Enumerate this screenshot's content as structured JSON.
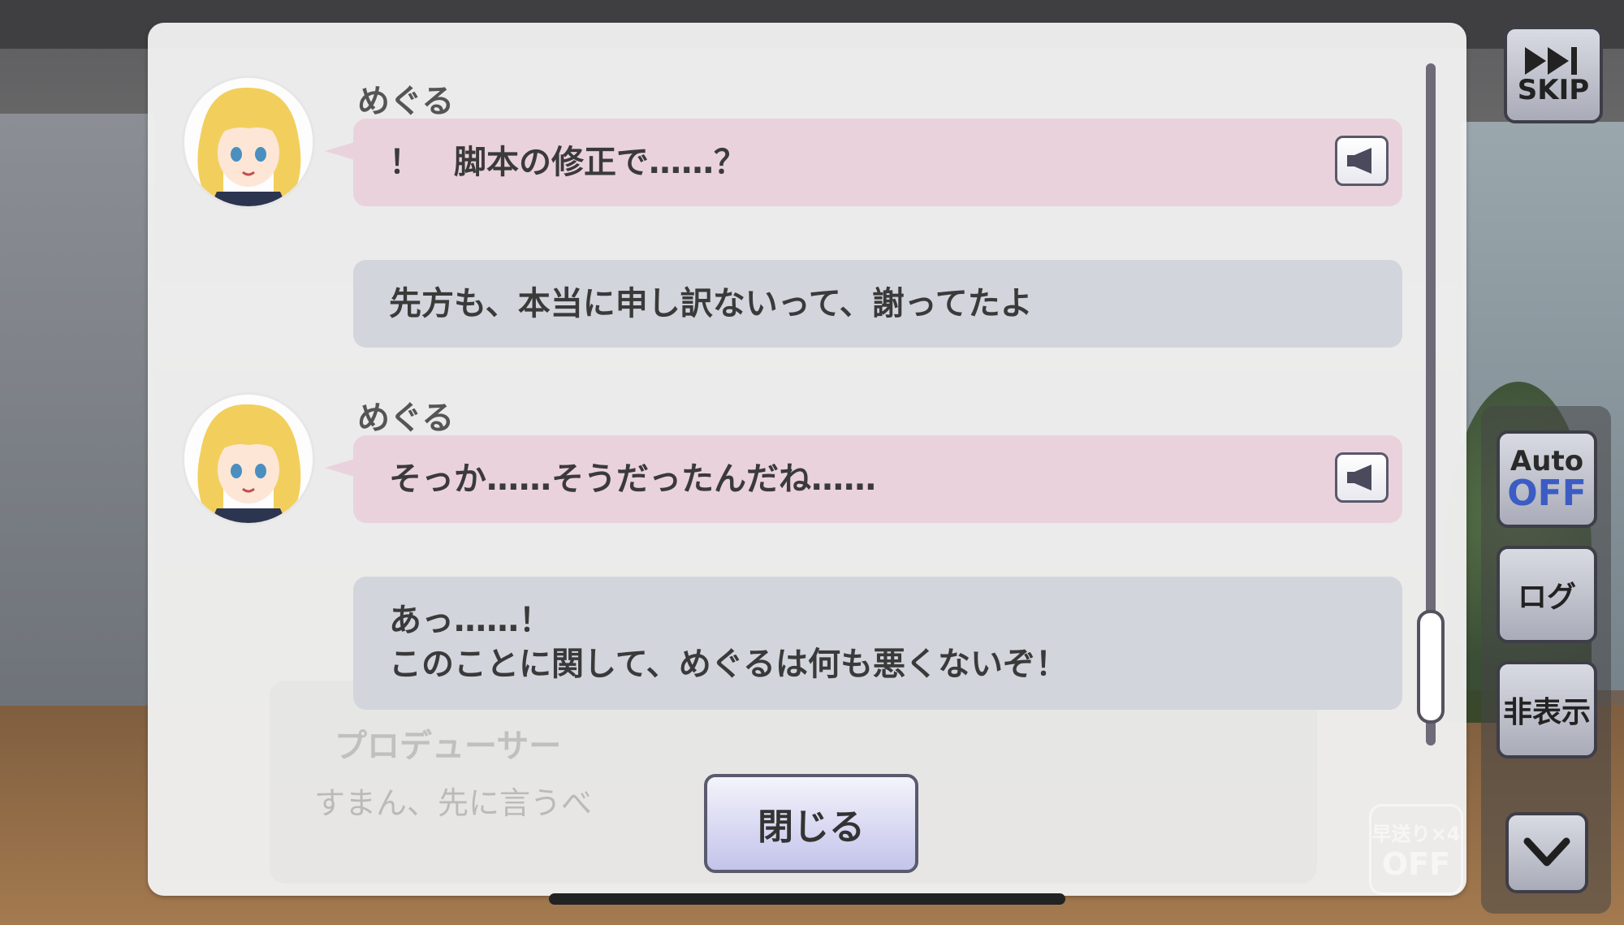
{
  "log": {
    "entries": [
      {
        "speaker": "めぐる",
        "text": "！　脚本の修正で……？",
        "has_voice": true
      },
      {
        "speaker": "",
        "text": "先方も、本当に申し訳ないって、謝ってたよ",
        "has_voice": false
      },
      {
        "speaker": "めぐる",
        "text": "そっか……そうだったんだね……",
        "has_voice": true
      },
      {
        "speaker": "",
        "text_line1": "あっ……！",
        "text_line2": "このことに関して、めぐるは何も悪くないぞ！",
        "has_voice": false
      }
    ],
    "close_label": "閉じる"
  },
  "background_dialog": {
    "speaker": "プロデューサー",
    "text": "すまん、先に言うべ"
  },
  "controls": {
    "skip_label": "SKIP",
    "auto_label": "Auto",
    "auto_state": "OFF",
    "log_label": "ログ",
    "hide_label": "非表示",
    "fast_forward_label": "早送り×4",
    "fast_forward_state": "OFF"
  },
  "colors": {
    "pink_bubble": "#ead2dc",
    "gray_bubble": "#d2d5dc",
    "auto_off": "#3c5cc4"
  },
  "icons": [
    "skip-icon",
    "speaker-icon",
    "chevron-down-icon",
    "avatar-megururu"
  ]
}
